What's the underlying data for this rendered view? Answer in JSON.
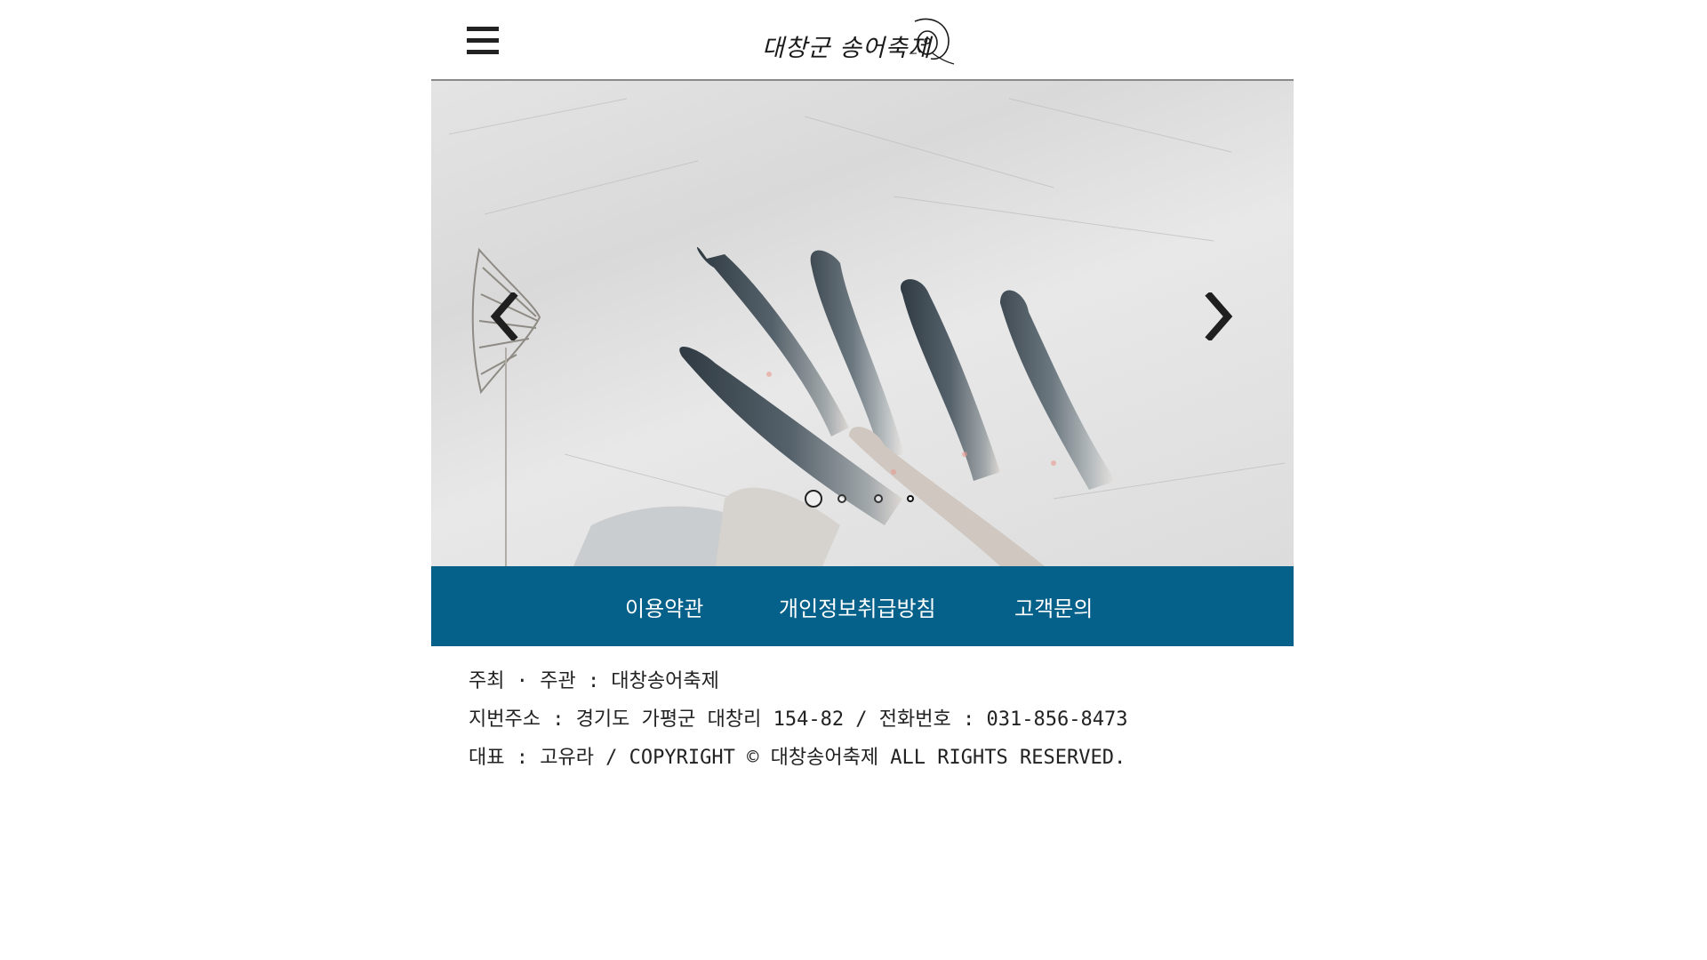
{
  "header": {
    "menu_icon": "hamburger-menu-icon",
    "logo_text": "대창군 송어축제",
    "logo_icon": "fish-emblem-icon"
  },
  "slider": {
    "prev_icon": "chevron-left-icon",
    "next_icon": "chevron-right-icon",
    "slide_image": "ice-fishing-trout-photo",
    "dot_count": 4,
    "active_dot": 1
  },
  "footer_nav": {
    "terms": "이용약관",
    "privacy": "개인정보취급방침",
    "contact": "고객문의",
    "background": "#05608a"
  },
  "info": {
    "line1": "주최 · 주관 : 대창송어축제",
    "line2": "지번주소 : 경기도 가평군 대창리 154-82  / 전화번호 : 031-856-8473",
    "line3": "대표 : 고유라 / COPYRIGHT © 대창송어축제 ALL RIGHTS RESERVED."
  }
}
